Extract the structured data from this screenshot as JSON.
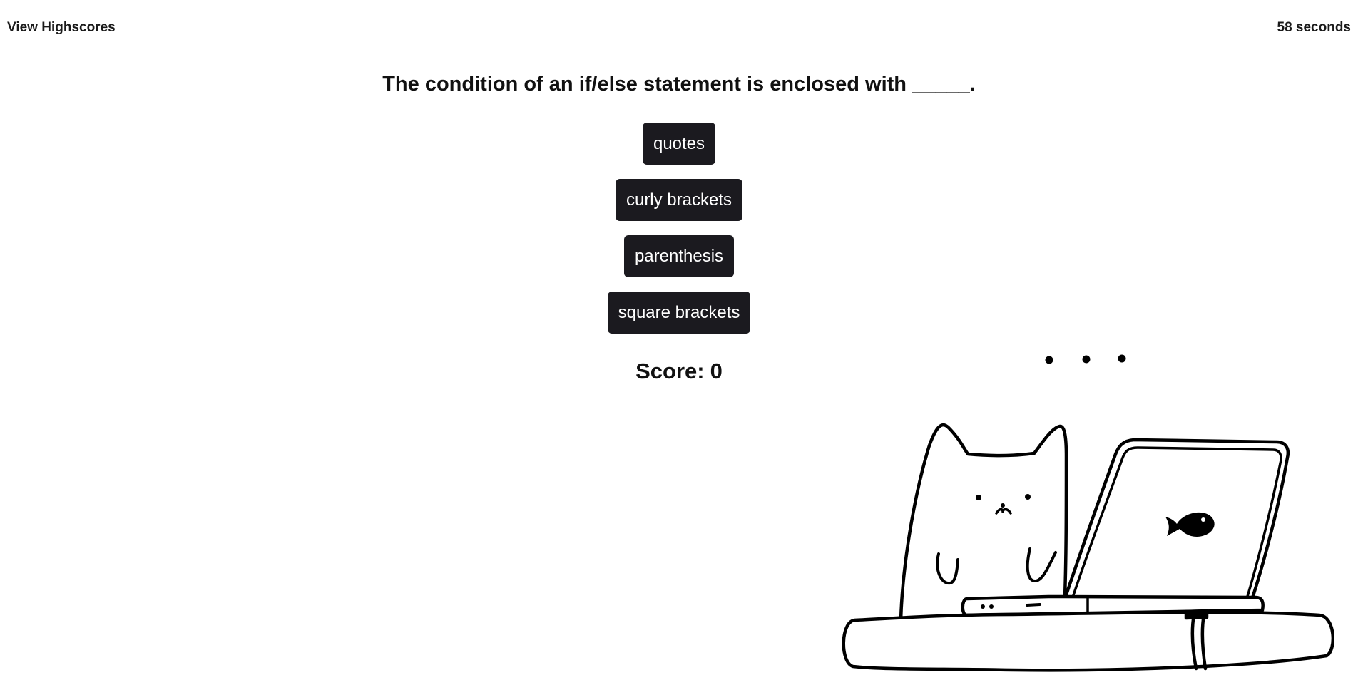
{
  "header": {
    "highscores_label": "View Highscores",
    "timer_label": "58 seconds"
  },
  "quiz": {
    "question": "The condition of an if/else statement is enclosed with _____.",
    "choices": [
      {
        "label": "quotes"
      },
      {
        "label": "curly brackets"
      },
      {
        "label": "parenthesis"
      },
      {
        "label": "square brackets"
      }
    ],
    "score_label": "Score:",
    "score_value": "0"
  },
  "illustration": {
    "icon": "cat-with-laptop-icon",
    "colors": {
      "line": "#000000",
      "fill": "#ffffff"
    }
  }
}
